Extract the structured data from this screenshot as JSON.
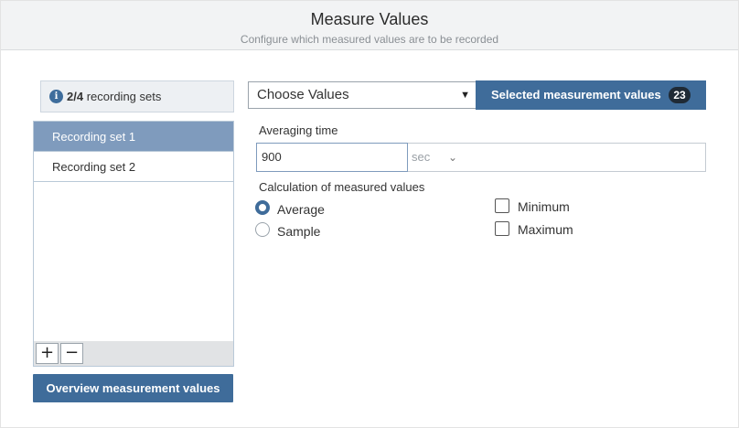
{
  "header": {
    "title": "Measure Values",
    "subtitle": "Configure which measured values are to be recorded"
  },
  "recording_sets": {
    "info_icon": "info-icon",
    "count_current": "2",
    "count_separator": "/",
    "count_total": "4",
    "count_suffix": " recording sets",
    "items": [
      {
        "label": "Recording set 1",
        "selected": true
      },
      {
        "label": "Recording set 2",
        "selected": false
      }
    ],
    "add_label": "+",
    "remove_label": "−"
  },
  "overview_button": {
    "label": "Overview measurement values"
  },
  "choose_values": {
    "value": "Choose Values",
    "caret": "▼"
  },
  "selected_values": {
    "label": "Selected measurement values",
    "count": "23"
  },
  "averaging": {
    "label": "Averaging time",
    "value": "900",
    "unit": "sec",
    "unit_chevron": "⌄"
  },
  "calculation": {
    "label": "Calculation of measured values",
    "options": [
      {
        "label": "Average",
        "checked": true
      },
      {
        "label": "Sample",
        "checked": false
      }
    ],
    "checkboxes": [
      {
        "label": "Minimum",
        "checked": false
      },
      {
        "label": "Maximum",
        "checked": false
      }
    ]
  },
  "colors": {
    "accent": "#3f6c9a",
    "selected_row": "#7f9bbd",
    "header_bg": "#f2f3f4"
  }
}
